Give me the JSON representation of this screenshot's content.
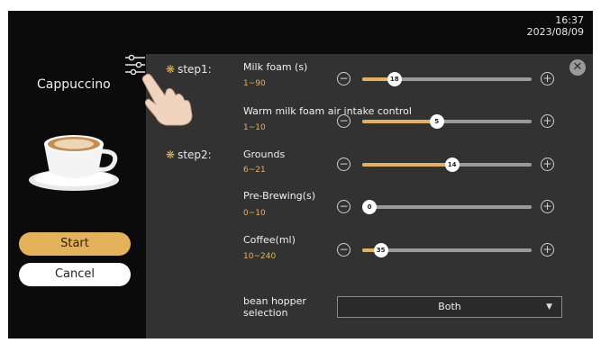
{
  "clock": {
    "time": "16:37",
    "date": "2023/08/09"
  },
  "drink": {
    "name": "Cappuccino"
  },
  "buttons": {
    "start": "Start",
    "cancel": "Cancel"
  },
  "steps": [
    {
      "label": "step1:"
    },
    {
      "label": "step2:"
    }
  ],
  "settings": [
    {
      "label": "Milk foam (s)",
      "range": "1~90",
      "value": "18",
      "fraction": 0.19
    },
    {
      "label": "Warm milk foam air intake control",
      "range": "1~10",
      "value": "5",
      "fraction": 0.44
    },
    {
      "label": "Grounds",
      "range": "6~21",
      "value": "14",
      "fraction": 0.53
    },
    {
      "label": "Pre-Brewing(s)",
      "range": "0~10",
      "value": "0",
      "fraction": 0.0
    },
    {
      "label": "Coffee(ml)",
      "range": "10~240",
      "value": "35",
      "fraction": 0.11
    }
  ],
  "bean_hopper": {
    "label_line1": "bean hopper",
    "label_line2": "selection",
    "value": "Both"
  },
  "colors": {
    "accent": "#e4b25a",
    "panel": "#323232",
    "background": "#0b0b0b"
  },
  "icons": {
    "close": "close-icon",
    "minus": "minus-circle-icon",
    "plus": "plus-circle-icon",
    "settings": "sliders-settings-icon",
    "pointer": "hand-pointer-icon",
    "dropdown": "caret-down-icon"
  }
}
